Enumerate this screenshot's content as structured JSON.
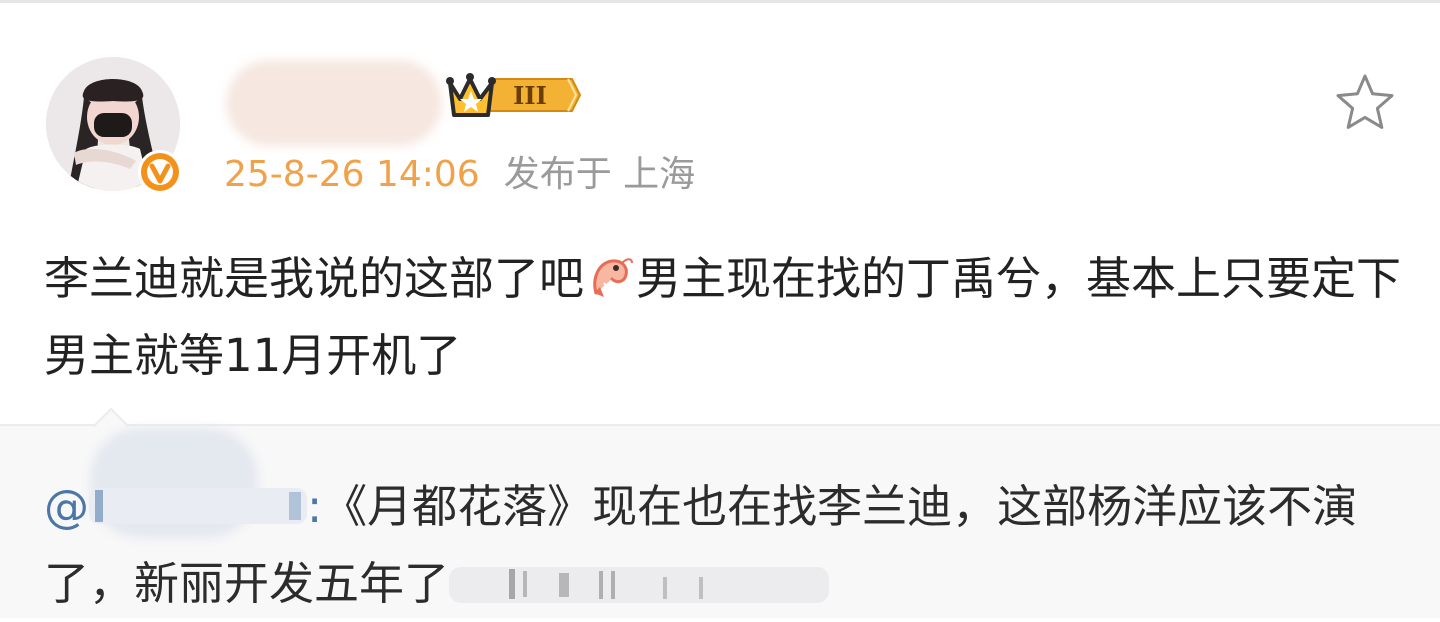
{
  "post": {
    "timestamp": "25-8-26 14:06",
    "source": "发布于 上海",
    "text_part1": "李兰迪就是我说的这部了吧",
    "text_part2": "男主现在找的丁禹兮，基本上只要定下男主就等11月开机了",
    "emoji_name": "shrimp-emoji",
    "member_level": "III",
    "avatar_icon": "avatar-icon",
    "verified_icon": "verified-v-icon",
    "favorite_icon": "star-outline-icon"
  },
  "quote": {
    "mention_prefix": "@",
    "separator": ":",
    "text": "《月都花落》现在也在找李兰迪，这部杨洋应该不演了，新丽开发五年了"
  },
  "colors": {
    "timestamp": "#f0a24a",
    "meta_gray": "#9a9a9a",
    "link_blue": "#4b76a7",
    "badge_orange": "#f2921b",
    "quote_bg": "#f8f8f9"
  }
}
